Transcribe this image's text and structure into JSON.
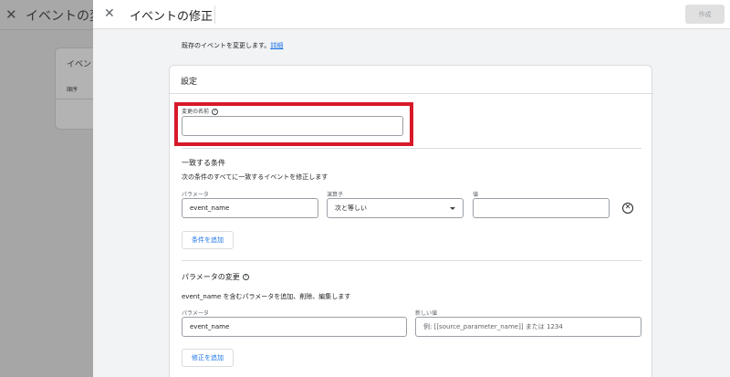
{
  "background": {
    "title": "イベントの変",
    "card_title": "イベン",
    "card_subtitle": "順序"
  },
  "header": {
    "title": "イベントの修正",
    "create_label": "作成"
  },
  "description": {
    "text": "既存のイベントを変更します。",
    "link": "詳細"
  },
  "settings": {
    "title": "設定",
    "name_label": "変更の名前",
    "name_value": ""
  },
  "conditions": {
    "title": "一致する条件",
    "description": "次の条件のすべてに一致するイベントを修正します",
    "param_label": "パラメータ",
    "param_value": "event_name",
    "operator_label": "演算子",
    "operator_value": "次と等しい",
    "value_label": "値",
    "value_value": "",
    "add_label": "条件を追加"
  },
  "param_changes": {
    "title": "パラメータの変更",
    "description": "event_name を含むパラメータを追加、削除、編集します",
    "param_label": "パラメータ",
    "param_value": "event_name",
    "new_value_label": "新しい値",
    "new_value_placeholder": "例: [[source_parameter_name]] または 1234",
    "add_label": "修正を追加"
  },
  "colors": {
    "accent": "#1a73e8",
    "highlight": "#d7192a"
  }
}
